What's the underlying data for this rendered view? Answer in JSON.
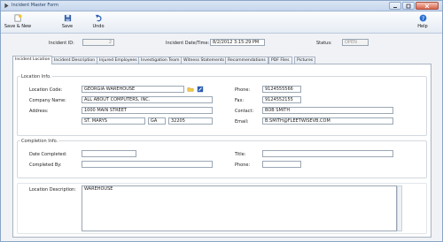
{
  "window": {
    "title": "Incident Master Form"
  },
  "toolbar": {
    "save_new_label": "Save & New",
    "save_label": "Save",
    "undo_label": "Undo",
    "help_label": "Help"
  },
  "header": {
    "incident_id_label": "Incident ID:",
    "incident_id_value": "2",
    "datetime_label": "Incident Date/Time:",
    "datetime_value": "8/2/2012 3:15:29 PM",
    "status_label": "Status:",
    "status_value": "OPEN"
  },
  "tabs": [
    {
      "label": "Incident Location",
      "active": true
    },
    {
      "label": "Incident Description",
      "active": false
    },
    {
      "label": "Injured Employees",
      "active": false
    },
    {
      "label": "Investigation Team",
      "active": false
    },
    {
      "label": "Witness Statements",
      "active": false
    },
    {
      "label": "Recommendations",
      "active": false
    },
    {
      "label": "PDF Files",
      "active": false
    },
    {
      "label": "Pictures",
      "active": false
    }
  ],
  "location_info": {
    "title": "Location Info.",
    "location_code_label": "Location Code:",
    "location_code_value": "GEORGIA WAREHOUSE",
    "company_name_label": "Company Name:",
    "company_name_value": "ALL ABOUT COMPUTERS, INC.",
    "address_label": "Address:",
    "address_value": "1000 MAIN STREET",
    "city_value": "ST. MARYS",
    "state_value": "GA",
    "zip_value": "32205",
    "phone_label": "Phone:",
    "phone_value": "9124555566",
    "fax_label": "Fax:",
    "fax_value": "9124552155",
    "contact_label": "Contact:",
    "contact_value": "BOB SMITH",
    "email_label": "Email:",
    "email_value": "B.SMITH@FLEETWISEVB.COM"
  },
  "completion_info": {
    "title": "Completion Info.",
    "date_completed_label": "Date Completed:",
    "date_completed_value": "",
    "completed_by_label": "Completed By:",
    "completed_by_value": "",
    "title_label": "Title:",
    "title_value": "",
    "phone_label": "Phone:",
    "phone_value": ""
  },
  "location_description": {
    "label": "Location Description:",
    "value": "WAREHOUSE"
  },
  "colors": {
    "titlebar": "#c6d6ec",
    "window_bg": "#f0f2f5",
    "accent_icon": "#2a5db0"
  }
}
